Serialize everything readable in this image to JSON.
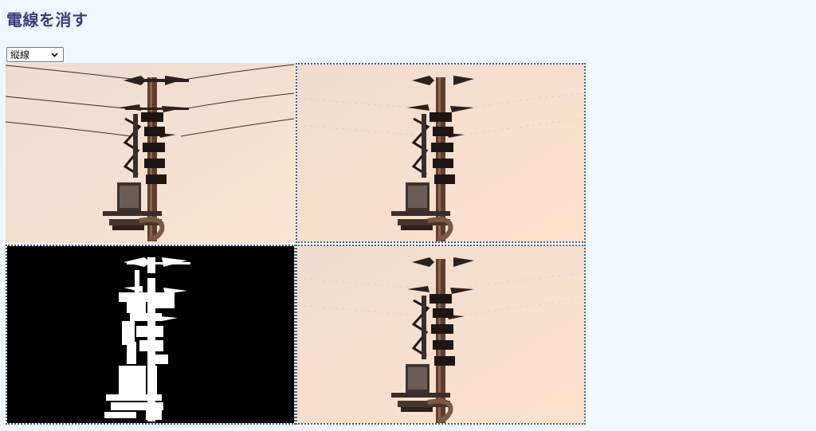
{
  "page": {
    "title": "電線を消す"
  },
  "controls": {
    "direction_select": {
      "selected": "縦線"
    }
  },
  "panels": {
    "original": {
      "description_icon": "utility-pole-photo-with-wires"
    },
    "wires_removed": {
      "description_icon": "utility-pole-photo-without-wires"
    },
    "mask": {
      "description_icon": "binary-mask"
    },
    "result": {
      "description_icon": "utility-pole-photo-without-wires"
    }
  },
  "colors": {
    "background": "#eff7ff",
    "title": "#3c3c7a",
    "sky_top": "#f1dccd",
    "sky_bottom": "#fbe1cc",
    "pole": "#6e4a36",
    "mask_bg": "#000000",
    "mask_fg": "#ffffff"
  }
}
